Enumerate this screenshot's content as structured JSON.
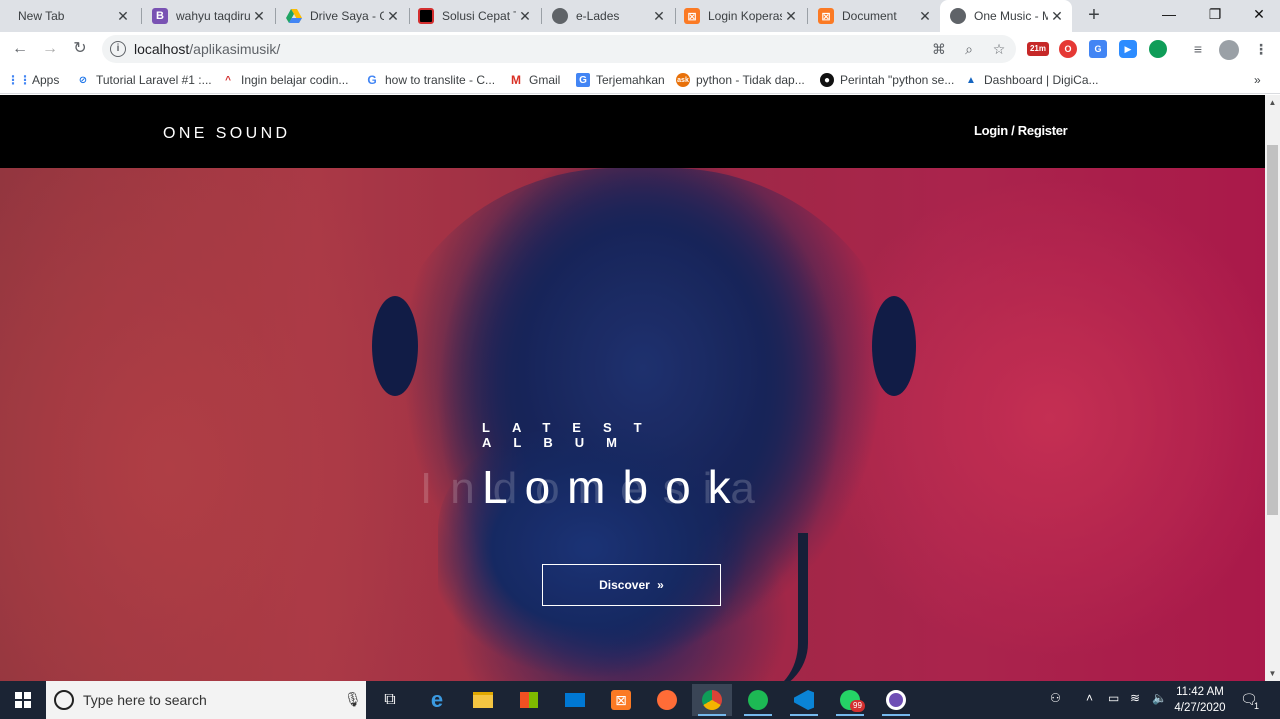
{
  "browser": {
    "tabs": [
      {
        "title": "New Tab",
        "icon": "new-tab-icon",
        "color": "#dee1e6"
      },
      {
        "title": "wahyu taqdirul",
        "icon": "bootstrap-icon",
        "color": "#7952b3"
      },
      {
        "title": "Drive Saya - Go",
        "icon": "google-drive-icon",
        "color": "#1fa463"
      },
      {
        "title": "Solusi Cepat Te",
        "icon": "red-square-icon",
        "color": "#d32f2f"
      },
      {
        "title": "e-Lades",
        "icon": "globe-icon",
        "color": "#5f6368"
      },
      {
        "title": "Login Koperasi",
        "icon": "xampp-icon",
        "color": "#fb7a24"
      },
      {
        "title": "Document",
        "icon": "xampp-icon",
        "color": "#fb7a24"
      },
      {
        "title": "One Music - M",
        "icon": "globe-icon",
        "color": "#5f6368",
        "active": true
      }
    ],
    "url_host": "localhost",
    "url_path": "/aplikasimusik/",
    "ext_badge": "21m",
    "bookmarks": [
      {
        "label": "Apps",
        "icon": "apps-grid-icon"
      },
      {
        "label": "Tutorial Laravel #1 :...",
        "icon": "laravel-icon"
      },
      {
        "label": "Ingin belajar codin...",
        "icon": "dicoding-icon"
      },
      {
        "label": "how to translite - C...",
        "icon": "google-icon"
      },
      {
        "label": "Gmail",
        "icon": "gmail-icon"
      },
      {
        "label": "Terjemahkan",
        "icon": "translate-icon"
      },
      {
        "label": "python - Tidak dap...",
        "icon": "ask-icon"
      },
      {
        "label": "Perintah \"python se...",
        "icon": "github-icon"
      },
      {
        "label": "Dashboard | DigiCa...",
        "icon": "digicamp-icon"
      }
    ],
    "bookmarks_overflow": "»"
  },
  "site": {
    "logo": "ONE SOUND",
    "login_label": "Login / Register",
    "hero": {
      "kicker": "LATEST ALBUM",
      "album_title": "Lombok",
      "ghost_title": "Indonesia",
      "button_label": "Discover",
      "button_chevron": "»"
    }
  },
  "taskbar": {
    "search_placeholder": "Type here to search",
    "time": "11:42 AM",
    "date": "4/27/2020",
    "whatsapp_badge": "99",
    "notification_count": "1",
    "apps": [
      "task-view-icon",
      "edge-icon",
      "file-explorer-icon",
      "store-icon",
      "mail-icon",
      "xampp-icon",
      "postman-icon",
      "chrome-icon",
      "spotify-icon",
      "vscode-icon",
      "whatsapp-icon",
      "screenrecorder-icon"
    ]
  },
  "colors": {
    "header_bg": "#000000",
    "hero_pink": "#c21d55",
    "hero_blue": "#1c2e6a",
    "taskbar_bg": "#1b2434"
  }
}
